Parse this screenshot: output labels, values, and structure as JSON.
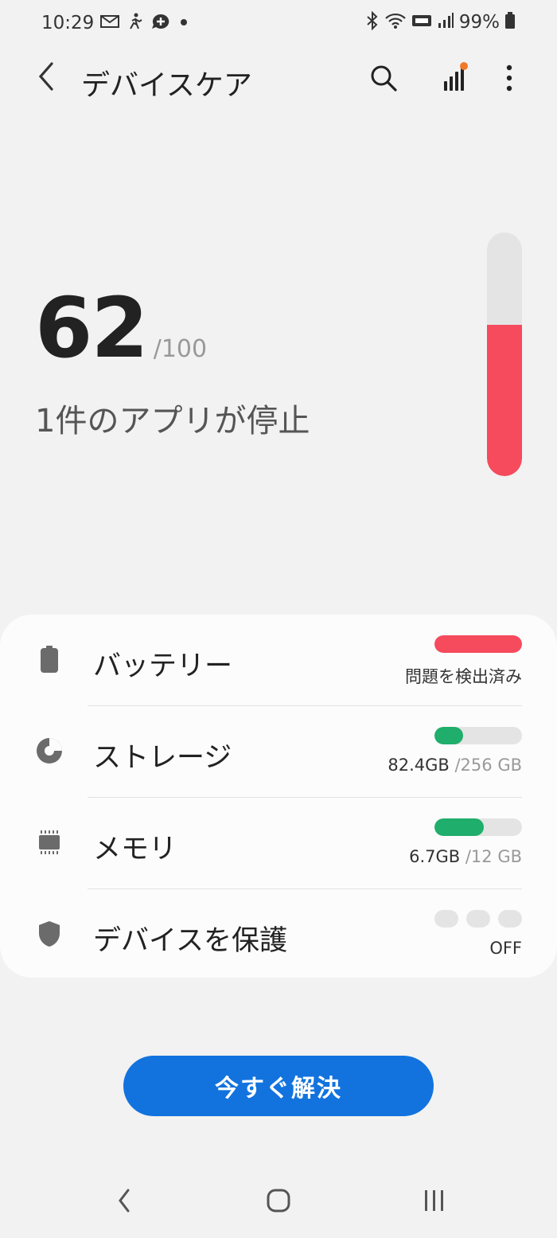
{
  "status_bar": {
    "time": "10:29",
    "battery_percent": "99%",
    "left_icons": [
      "mail-icon",
      "activity-icon",
      "chat-plus-icon",
      "dot-icon"
    ],
    "right_icons": [
      "bluetooth-icon",
      "wifi-icon",
      "volte-icon",
      "signal-icon",
      "battery-icon"
    ]
  },
  "app_bar": {
    "title": "デバイスケア",
    "actions": [
      "search-icon",
      "diagnostics-icon",
      "more-icon"
    ],
    "diagnostics_badge_color": "#f07a2a"
  },
  "score": {
    "value": "62",
    "max": "/100",
    "subtitle": "1件のアプリが停止",
    "fraction": 0.62,
    "gauge_color": "#f64a5d"
  },
  "items": [
    {
      "label": "バッテリー",
      "icon": "battery-icon",
      "status": "問題を検出済み",
      "bar_fraction": 1.0,
      "bar_color": "#f64a5d"
    },
    {
      "label": "ストレージ",
      "icon": "storage-icon",
      "used": "82.4GB",
      "total": "/256 GB",
      "bar_fraction": 0.33,
      "bar_color": "#1fae6b"
    },
    {
      "label": "メモリ",
      "icon": "memory-icon",
      "used": "6.7GB",
      "total": "/12 GB",
      "bar_fraction": 0.56,
      "bar_color": "#1fae6b"
    },
    {
      "label": "デバイスを保護",
      "icon": "shield-icon",
      "status": "OFF",
      "level_dots": 3
    }
  ],
  "fix_button": {
    "label": "今すぐ解決",
    "color": "#1273de"
  },
  "nav_bar": {
    "buttons": [
      "back-icon",
      "home-icon",
      "recents-icon"
    ]
  }
}
